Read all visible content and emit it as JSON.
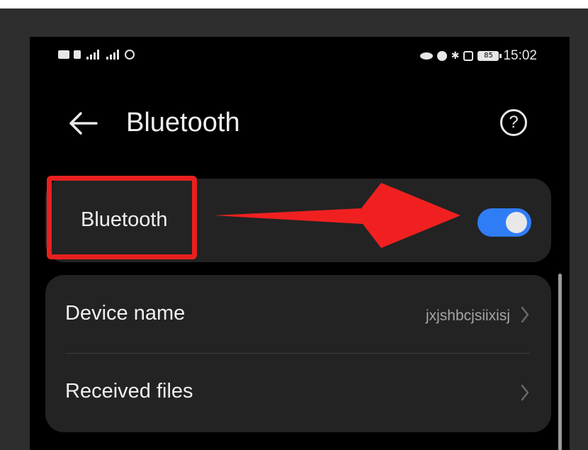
{
  "status_bar": {
    "time": "15:02",
    "battery_level": "85",
    "icons_left": [
      "hd-icon",
      "signal-icon",
      "signal-icon",
      "hotspot-icon"
    ],
    "icons_right": [
      "eye-icon",
      "alarm-icon",
      "bluetooth-icon",
      "vibrate-icon",
      "battery-icon"
    ]
  },
  "header": {
    "title": "Bluetooth",
    "back_icon": "back-arrow-icon",
    "help_icon": "help-icon",
    "help_glyph": "?"
  },
  "bluetooth_toggle": {
    "label": "Bluetooth",
    "enabled": true
  },
  "settings": {
    "device_name_label": "Device name",
    "device_name_value": "jxjshbcjsiixisj",
    "received_files_label": "Received files"
  },
  "annotation": {
    "highlight_color": "#e8201e",
    "arrow_color": "#f02020"
  },
  "colors": {
    "toggle_on": "#2f7df6",
    "card_bg": "#232323",
    "screen_bg": "#000000"
  }
}
